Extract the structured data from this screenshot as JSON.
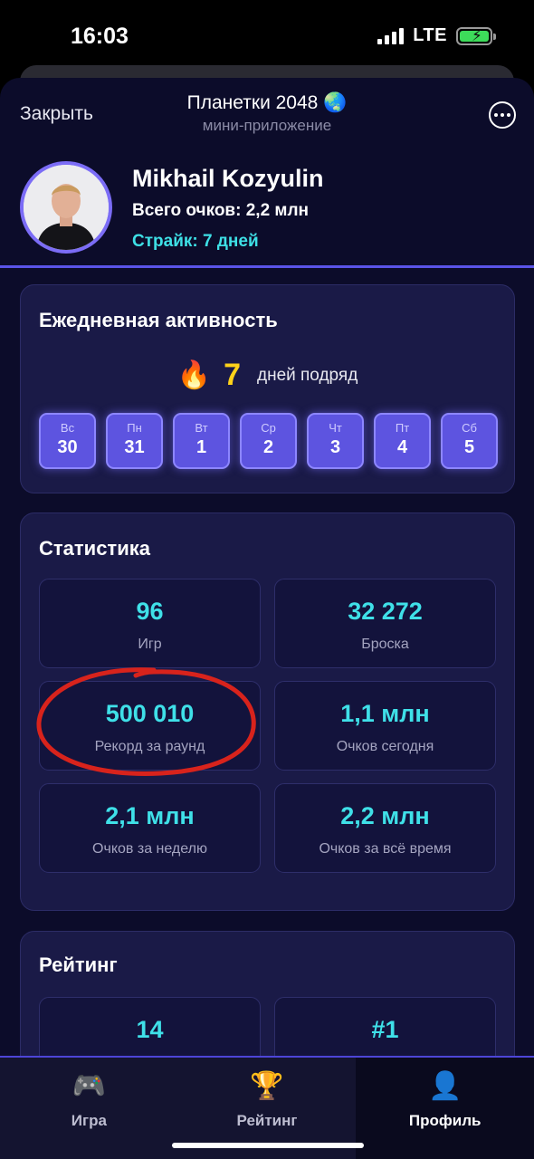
{
  "status_bar": {
    "time": "16:03",
    "network": "LTE"
  },
  "header": {
    "close_label": "Закрыть",
    "title": "Планетки 2048 🌏",
    "subtitle": "мини-приложение"
  },
  "profile": {
    "name": "Mikhail Kozyulin",
    "total_points": "Всего очков: 2,2 млн",
    "streak": "Страйк: 7 дней"
  },
  "daily_activity": {
    "title": "Ежедневная активность",
    "streak_icon": "🔥",
    "streak_count": "7",
    "streak_text": "дней подряд",
    "days": [
      {
        "label": "Вс",
        "num": "30"
      },
      {
        "label": "Пн",
        "num": "31"
      },
      {
        "label": "Вт",
        "num": "1"
      },
      {
        "label": "Ср",
        "num": "2"
      },
      {
        "label": "Чт",
        "num": "3"
      },
      {
        "label": "Пт",
        "num": "4"
      },
      {
        "label": "Сб",
        "num": "5"
      }
    ]
  },
  "stats": {
    "title": "Статистика",
    "items": [
      {
        "value": "96",
        "label": "Игр"
      },
      {
        "value": "32 272",
        "label": "Броска"
      },
      {
        "value": "500 010",
        "label": "Рекорд за раунд"
      },
      {
        "value": "1,1 млн",
        "label": "Очков сегодня"
      },
      {
        "value": "2,1 млн",
        "label": "Очков за неделю"
      },
      {
        "value": "2,2 млн",
        "label": "Очков за всё время"
      }
    ]
  },
  "rating": {
    "title": "Рейтинг",
    "items": [
      {
        "value": "14"
      },
      {
        "value": "#1"
      }
    ]
  },
  "nav": {
    "items": [
      {
        "icon": "🎮",
        "label": "Игра"
      },
      {
        "icon": "🏆",
        "label": "Рейтинг"
      },
      {
        "icon": "👤",
        "label": "Профиль"
      }
    ],
    "active": "Профиль"
  },
  "colors": {
    "background": "#0c0c2a",
    "card": "#1a1a47",
    "accent": "#5d54e0",
    "value_cyan": "#3fe0e8",
    "streak_yellow": "#ffd21a",
    "annotation_red": "#d8231c"
  }
}
